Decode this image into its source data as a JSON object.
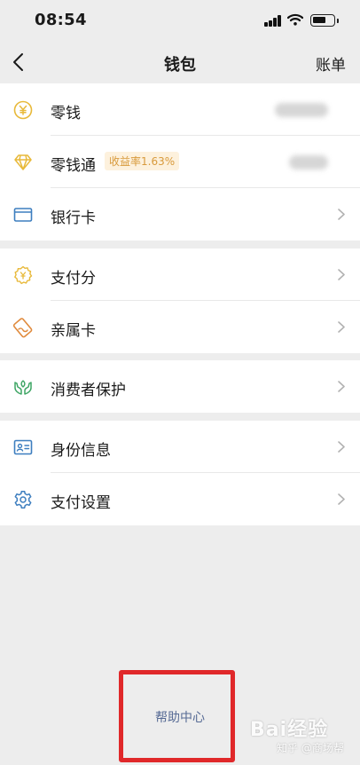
{
  "status_bar": {
    "time": "08:54"
  },
  "nav": {
    "title": "钱包",
    "right_action": "账单"
  },
  "groups": [
    {
      "items": [
        {
          "label": "零钱",
          "icon": "yuan-coin-icon"
        },
        {
          "label": "零钱通",
          "icon": "diamond-icon",
          "badge": "收益率1.63%"
        },
        {
          "label": "银行卡",
          "icon": "bank-card-icon"
        }
      ]
    },
    {
      "items": [
        {
          "label": "支付分",
          "icon": "payment-score-icon"
        },
        {
          "label": "亲属卡",
          "icon": "family-card-icon"
        }
      ]
    },
    {
      "items": [
        {
          "label": "消费者保护",
          "icon": "consumer-protection-icon"
        }
      ]
    },
    {
      "items": [
        {
          "label": "身份信息",
          "icon": "id-card-icon"
        },
        {
          "label": "支付设置",
          "icon": "settings-gear-icon"
        }
      ]
    }
  ],
  "footer": {
    "help_center": "帮助中心"
  },
  "watermark": {
    "baidu": "Bai经验",
    "zhihu": "知乎 @商场帮"
  },
  "colors": {
    "background": "#ededed",
    "icon_yellow": "#e8b93a",
    "icon_blue": "#3d7ebf",
    "icon_green": "#3da564",
    "icon_orange": "#e08a3c",
    "link_blue": "#576b95",
    "highlight_red": "#e0282a"
  }
}
